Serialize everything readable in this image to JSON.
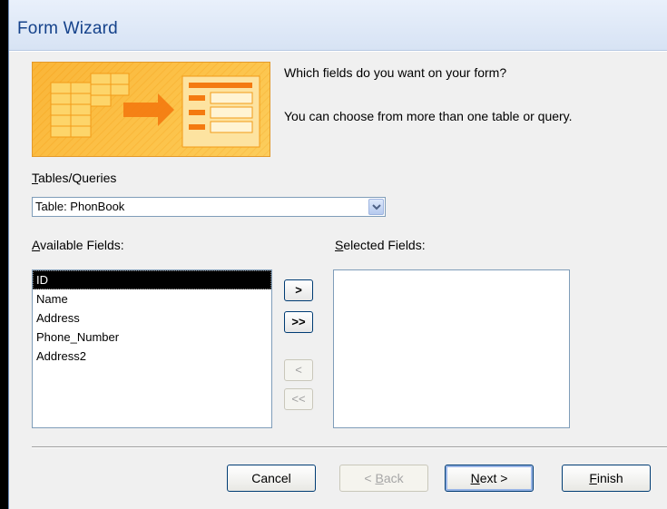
{
  "window": {
    "title": "Form Wizard"
  },
  "intro": {
    "line1": "Which fields do you want on your form?",
    "line2": "You can choose from more than one table or query."
  },
  "tables": {
    "label_mnemonic": "T",
    "label_rest": "ables/Queries",
    "selected": "Table: PhonBook"
  },
  "available": {
    "label_mnemonic": "A",
    "label_rest": "vailable Fields:",
    "items": [
      "ID",
      "Name",
      "Address",
      "Phone_Number",
      "Address2"
    ],
    "selected_index": 0
  },
  "selected_fields": {
    "label_mnemonic": "S",
    "label_rest": "elected Fields:",
    "items": []
  },
  "move_buttons": {
    "add_one": ">",
    "add_all": ">>",
    "remove_one": "<",
    "remove_all": "<<"
  },
  "footer": {
    "cancel": "Cancel",
    "back_prefix": "< ",
    "back_mnemonic": "B",
    "back_rest": "ack",
    "next_mnemonic": "N",
    "next_rest": "ext >",
    "finish_mnemonic": "F",
    "finish_rest": "inish"
  },
  "colors": {
    "title_text": "#15428b",
    "banner": "#f8a826",
    "selection": "#000000"
  }
}
